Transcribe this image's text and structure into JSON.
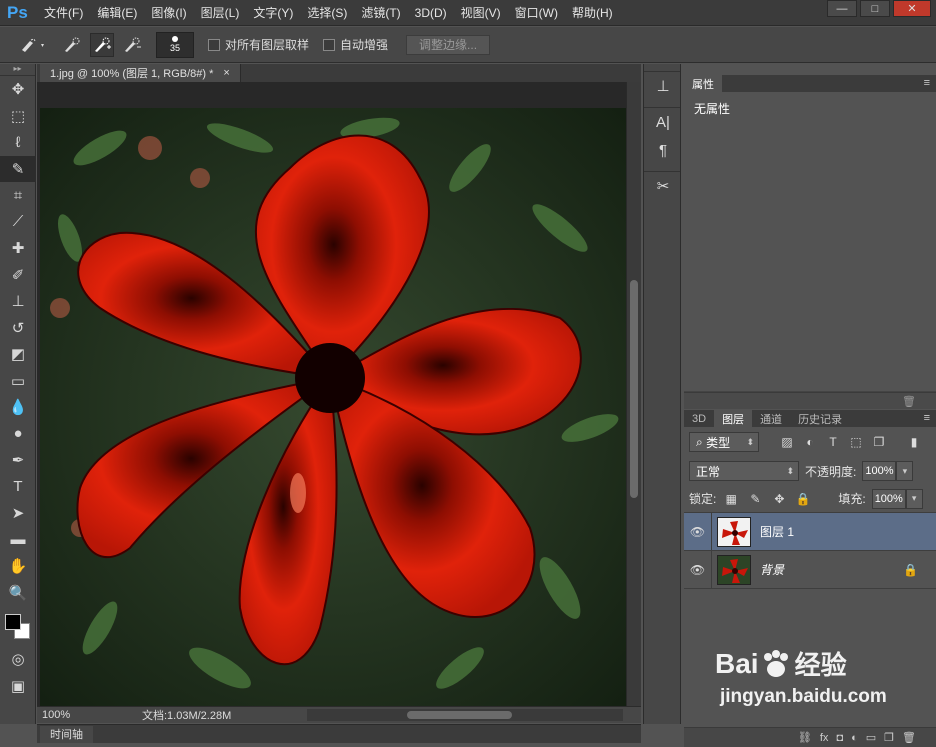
{
  "app": {
    "logo": "Ps"
  },
  "menu": [
    "文件(F)",
    "编辑(E)",
    "图像(I)",
    "图层(L)",
    "文字(Y)",
    "选择(S)",
    "滤镜(T)",
    "3D(D)",
    "视图(V)",
    "窗口(W)",
    "帮助(H)"
  ],
  "window_controls": {
    "minimize": "—",
    "restore": "□",
    "close": "✕"
  },
  "options": {
    "brush_size": "35",
    "sample_all_layers": "对所有图层取样",
    "auto_enhance": "自动增强",
    "refine_edge": "调整边缘..."
  },
  "document": {
    "tab_title": "1.jpg @ 100% (图层 1, RGB/8#) *",
    "tab_close": "×",
    "zoom": "100%",
    "doc_info": "文档:1.03M/2.28M"
  },
  "timeline": {
    "label": "时间轴"
  },
  "properties": {
    "tab": "属性",
    "body": "无属性"
  },
  "layers_panel": {
    "tabs": [
      "3D",
      "图层",
      "通道",
      "历史记录"
    ],
    "filter_kind": "类型",
    "blend_mode": "正常",
    "opacity_label": "不透明度:",
    "opacity_value": "100%",
    "lock_label": "锁定:",
    "fill_label": "填充:",
    "fill_value": "100%",
    "layers": [
      {
        "name": "图层 1",
        "selected": true
      },
      {
        "name": "背景",
        "selected": false,
        "locked": true
      }
    ]
  },
  "watermark": {
    "brand": "Bai",
    "brand2": "经验",
    "url": "jingyan.baidu.com"
  },
  "colors": {
    "accent_logo": "#44a6f5",
    "selected_layer": "#5c6d88",
    "flower": "#d11a0a"
  }
}
